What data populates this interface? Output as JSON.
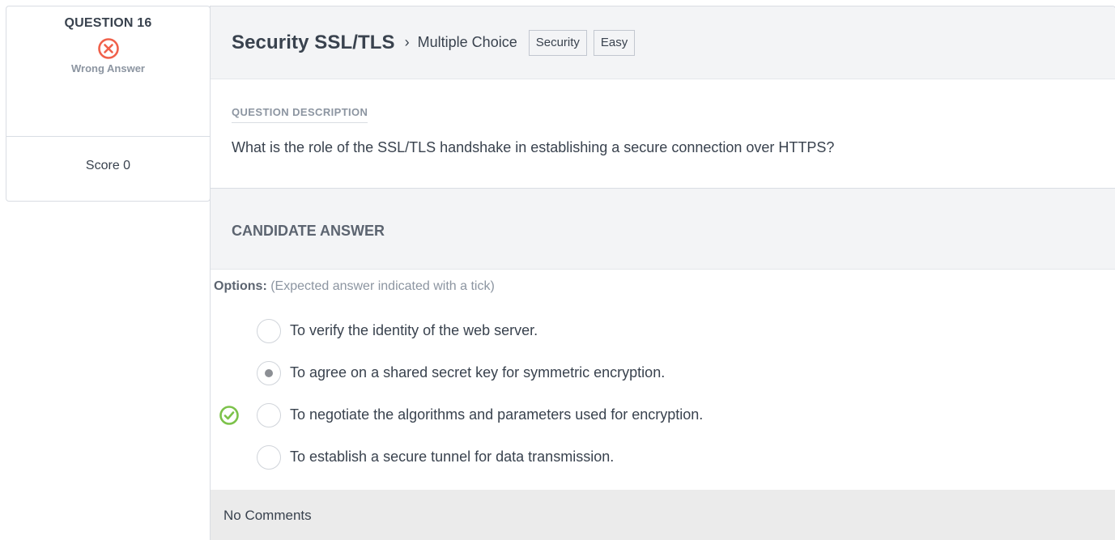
{
  "summary": {
    "question_label": "QUESTION 16",
    "status_text": "Wrong Answer",
    "status_icon": "x-circle-icon",
    "status_color": "#f0614b",
    "score": "Score 0"
  },
  "header": {
    "title": "Security SSL/TLS",
    "separator": "›",
    "question_type": "Multiple Choice",
    "tags": [
      "Security",
      "Easy"
    ]
  },
  "description": {
    "label": "QUESTION DESCRIPTION",
    "text": "What is the role of the SSL/TLS handshake in establishing a secure connection over HTTPS?"
  },
  "answer": {
    "title": "CANDIDATE ANSWER",
    "options_label": "Options:",
    "options_hint": "(Expected answer indicated with a tick)",
    "correct_color": "#7cc24a",
    "options": [
      {
        "text": "To verify the identity of the web server.",
        "selected": false,
        "expected": false
      },
      {
        "text": "To agree on a shared secret key for symmetric encryption.",
        "selected": true,
        "expected": false
      },
      {
        "text": "To negotiate the algorithms and parameters used for encryption.",
        "selected": false,
        "expected": true
      },
      {
        "text": "To establish a secure tunnel for data transmission.",
        "selected": false,
        "expected": false
      }
    ]
  },
  "comments": "No Comments"
}
